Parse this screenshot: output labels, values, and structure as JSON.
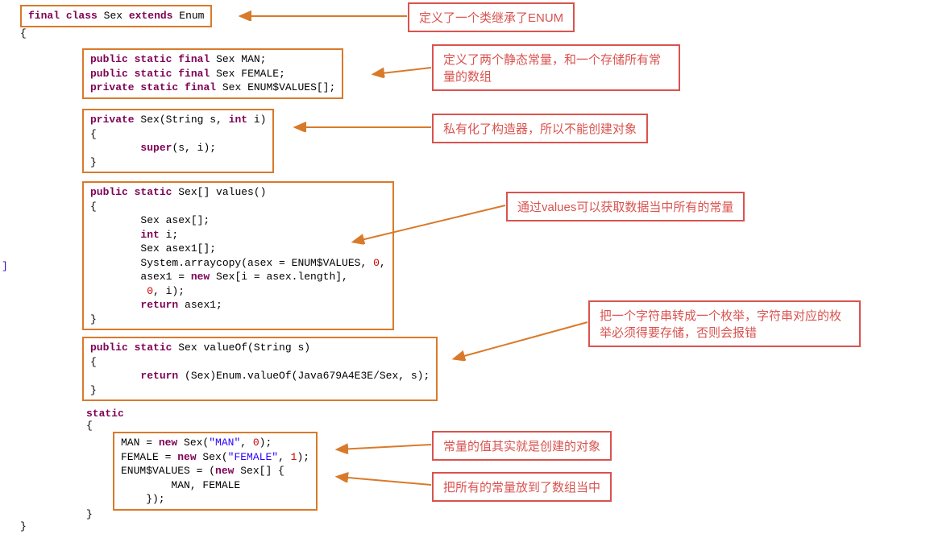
{
  "box1": {
    "l1": "final class Sex extends Enum"
  },
  "braces": {
    "open1": "{",
    "open2": "{",
    "close1": "}",
    "static": "static",
    "close2": "}",
    "leftMark": "]"
  },
  "box2": {
    "l1": "public static final Sex MAN;",
    "l2": "public static final Sex FEMALE;",
    "l3": "private static final Sex ENUM$VALUES[];"
  },
  "box3": {
    "l1": "private Sex(String s, int i)",
    "l2": "{",
    "l3": "        super(s, i);",
    "l4": "}"
  },
  "box4": {
    "l1": "public static Sex[] values()",
    "l2": "{",
    "l3": "        Sex asex[];",
    "l4": "        int i;",
    "l5": "        Sex asex1[];",
    "l6a": "        System.arraycopy(asex = ENUM$VALUES, ",
    "l6b": "0",
    "l6c": ",",
    "l7": "        asex1 = new Sex[i = asex.length],",
    "l8a": "         ",
    "l8b": "0",
    "l8c": ", i);",
    "l9": "        return asex1;",
    "l10": "}"
  },
  "box5": {
    "l1": "public static Sex valueOf(String s)",
    "l2": "{",
    "l3": "        return (Sex)Enum.valueOf(Java679A4E3E/Sex, s);",
    "l4": "}"
  },
  "box6": {
    "l1a": "MAN = ",
    "l1b": "new",
    "l1c": " Sex(",
    "l1d": "\"MAN\"",
    "l1e": ", ",
    "l1f": "0",
    "l1g": ");",
    "l2a": "FEMALE = ",
    "l2b": "new",
    "l2c": " Sex(",
    "l2d": "\"FEMALE\"",
    "l2e": ", ",
    "l2f": "1",
    "l2g": ");",
    "l3a": "ENUM$VALUES = (",
    "l3b": "new",
    "l3c": " Sex[] {",
    "l4": "        MAN, FEMALE",
    "l5": "    });"
  },
  "comments": {
    "c1": "定义了一个类继承了ENUM",
    "c2": "定义了两个静态常量，和一个存储所有常量的数组",
    "c3": "私有化了构造器，所以不能创建对象",
    "c4": "通过values可以获取数据当中所有的常量",
    "c5": "把一个字符串转成一个枚举，字符串对应的枚举必须得要存储，否则会报错",
    "c6": "常量的值其实就是创建的对象",
    "c7": "把所有的常量放到了数组当中"
  },
  "kw": {
    "final": "final",
    "class": "class",
    "extends": "extends",
    "Enum": "Enum",
    "public": "public",
    "static": "static",
    "private": "private",
    "Sex": "Sex",
    "String": "String",
    "int": "int",
    "super": "super",
    "return": "return",
    "new": "new"
  }
}
